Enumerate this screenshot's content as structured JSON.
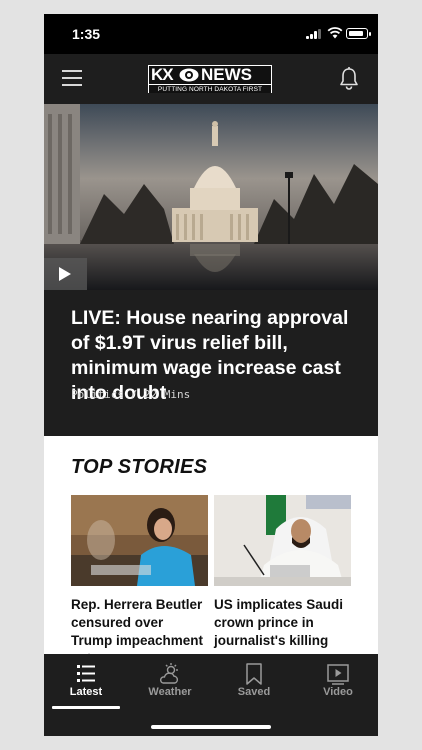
{
  "status_bar": {
    "time": "1:35",
    "icons": [
      "signal-icon",
      "wifi-icon",
      "battery-icon"
    ],
    "battery_level": 0.9
  },
  "header": {
    "menu_icon": "hamburger-menu-icon",
    "logo": {
      "call_sign": "KX",
      "network": "NEWS",
      "tagline": "PUTTING NORTH DAKOTA FIRST"
    },
    "notifications_icon": "bell-icon"
  },
  "hero": {
    "play_icon": "play-icon",
    "headline": "LIVE: House nearing approval of $1.9T virus relief bill, minimum wage increase cast into doubt",
    "meta": "Politics / 22 Mins"
  },
  "top_stories": {
    "title": "TOP STORIES",
    "items": [
      {
        "headline": "Rep. Herrera Beutler censured over Trump impeachment vote"
      },
      {
        "headline": "US implicates Saudi crown prince in journalist's killing"
      }
    ]
  },
  "tab_bar": {
    "tabs": [
      {
        "label": "Latest",
        "icon": "list-icon",
        "active": true
      },
      {
        "label": "Weather",
        "icon": "weather-icon",
        "active": false
      },
      {
        "label": "Saved",
        "icon": "bookmark-icon",
        "active": false
      },
      {
        "label": "Video",
        "icon": "video-play-icon",
        "active": false
      }
    ]
  },
  "colors": {
    "background": "#e3e3e3",
    "dark_surface": "#1e1e1e",
    "active_tab": "#ffffff",
    "inactive_tab": "#9a9a9a"
  }
}
